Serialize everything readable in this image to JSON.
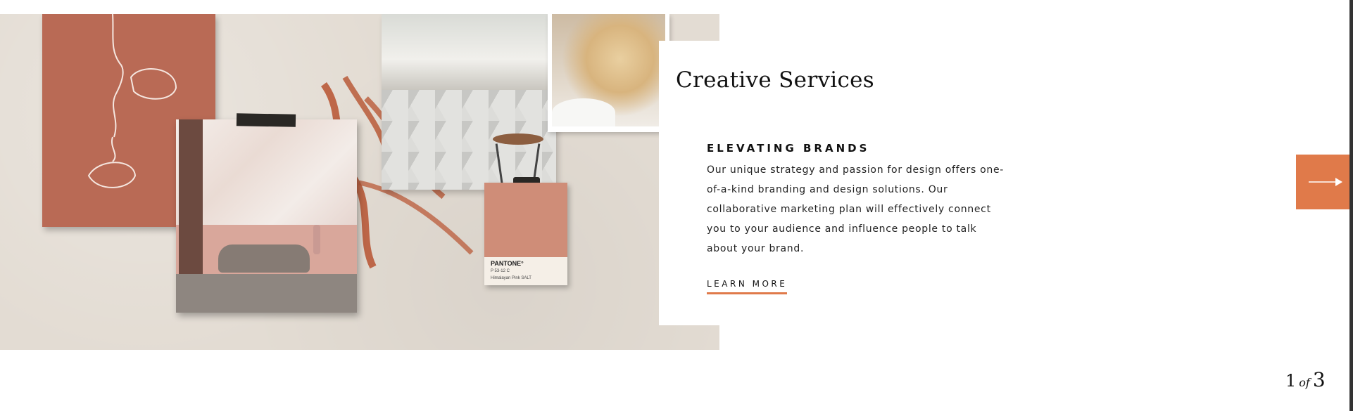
{
  "slide": {
    "title": "Creative Services",
    "heading": "ELEVATING BRANDS",
    "body": "Our unique strategy and passion for design offers one-of-a-kind branding and design solutions. Our collaborative marketing plan will effectively connect you to your audience and influence people to talk about your brand.",
    "cta_label": "LEARN MORE"
  },
  "pantone_card": {
    "title": "PANTONE°",
    "code": "P 53-12 C",
    "name": "Himalayan Pink SALT"
  },
  "pagination": {
    "current": "1",
    "separator": "of",
    "total": "3"
  },
  "icons": {
    "next": "arrow-right-icon"
  },
  "colors": {
    "accent": "#e07a4a",
    "terracotta": "#b96a55",
    "background": "#e3dcd3"
  }
}
